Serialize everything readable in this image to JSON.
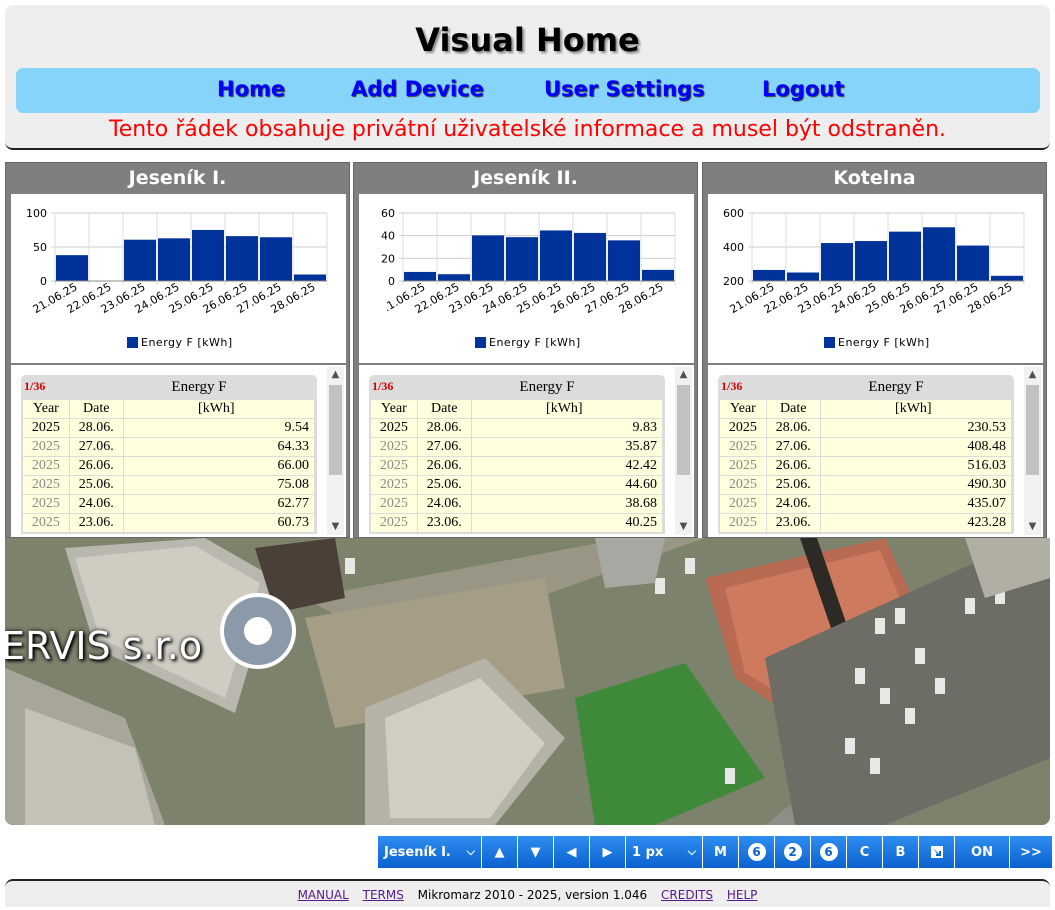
{
  "header": {
    "title": "Visual Home",
    "nav": [
      {
        "label": "Home",
        "name": "nav-home"
      },
      {
        "label": "Add Device",
        "name": "nav-add-device"
      },
      {
        "label": "User Settings",
        "name": "nav-user-settings"
      },
      {
        "label": "Logout",
        "name": "nav-logout"
      }
    ],
    "notice": "Tento řádek obsahuje privátní uživatelské informace a musel být odstraněn."
  },
  "panels": [
    {
      "title": "Jeseník I.",
      "table": {
        "page": "1/36",
        "column_title": "Energy F",
        "headers": [
          "Year",
          "Date",
          "[kWh]"
        ],
        "rows": [
          [
            "2025",
            "28.06.",
            "9.54"
          ],
          [
            "2025",
            "27.06.",
            "64.33"
          ],
          [
            "2025",
            "26.06.",
            "66.00"
          ],
          [
            "2025",
            "25.06.",
            "75.08"
          ],
          [
            "2025",
            "24.06.",
            "62.77"
          ],
          [
            "2025",
            "23.06.",
            "60.73"
          ]
        ]
      }
    },
    {
      "title": "Jeseník II.",
      "table": {
        "page": "1/36",
        "column_title": "Energy F",
        "headers": [
          "Year",
          "Date",
          "[kWh]"
        ],
        "rows": [
          [
            "2025",
            "28.06.",
            "9.83"
          ],
          [
            "2025",
            "27.06.",
            "35.87"
          ],
          [
            "2025",
            "26.06.",
            "42.42"
          ],
          [
            "2025",
            "25.06.",
            "44.60"
          ],
          [
            "2025",
            "24.06.",
            "38.68"
          ],
          [
            "2025",
            "23.06.",
            "40.25"
          ]
        ]
      }
    },
    {
      "title": "Kotelna",
      "table": {
        "page": "1/36",
        "column_title": "Energy F",
        "headers": [
          "Year",
          "Date",
          "[kWh]"
        ],
        "rows": [
          [
            "2025",
            "28.06.",
            "230.53"
          ],
          [
            "2025",
            "27.06.",
            "408.48"
          ],
          [
            "2025",
            "26.06.",
            "516.03"
          ],
          [
            "2025",
            "25.06.",
            "490.30"
          ],
          [
            "2025",
            "24.06.",
            "435.07"
          ],
          [
            "2025",
            "23.06.",
            "423.28"
          ]
        ]
      }
    }
  ],
  "chart_data": [
    {
      "type": "bar",
      "categories": [
        "21.06.25",
        "22.06.25",
        "23.06.25",
        "24.06.25",
        "25.06.25",
        "26.06.25",
        "27.06.25",
        "28.06.25"
      ],
      "series": [
        {
          "name": "Energy F [kWh]",
          "values": [
            38,
            0.5,
            60.73,
            62.77,
            75.08,
            66.0,
            64.33,
            9.54
          ]
        }
      ],
      "yticks": [
        0,
        50,
        100
      ],
      "ylim": [
        0,
        100
      ],
      "grid": true,
      "legend": "bottom",
      "color": "#00339a"
    },
    {
      "type": "bar",
      "categories": [
        ".1.06.25",
        "22.06.25",
        "23.06.25",
        "24.06.25",
        "25.06.25",
        "26.06.25",
        "27.06.25",
        "28.06.25"
      ],
      "series": [
        {
          "name": "Energy F [kWh]",
          "values": [
            8,
            6,
            40.25,
            38.68,
            44.6,
            42.42,
            35.87,
            9.83
          ]
        }
      ],
      "yticks": [
        0,
        20,
        40,
        60
      ],
      "ylim": [
        0,
        60
      ],
      "grid": true,
      "legend": "bottom",
      "color": "#00339a"
    },
    {
      "type": "bar",
      "categories": [
        "21.06.25",
        "22.06.25",
        "23.06.25",
        "24.06.25",
        "25.06.25",
        "26.06.25",
        "27.06.25",
        "28.06.25"
      ],
      "series": [
        {
          "name": "Energy F [kWh]",
          "values": [
            265,
            250,
            423.28,
            435.07,
            490.3,
            516.03,
            408.48,
            230.53
          ]
        }
      ],
      "yticks": [
        200,
        400,
        600
      ],
      "ylim": [
        200,
        600
      ],
      "grid": true,
      "legend": "bottom",
      "color": "#00339a"
    }
  ],
  "map": {
    "label": "ERVIS s.r.o"
  },
  "toolbar": {
    "device_select": "Jeseník I.",
    "up": "▲",
    "down": "▼",
    "left": "◀",
    "right": "▶",
    "px_select": "1 px",
    "m": "M",
    "b6a": "6",
    "b2": "2",
    "b6b": "6",
    "c": "C",
    "b": "B",
    "on": "ON",
    "more": ">>"
  },
  "footer": {
    "manual": "MANUAL",
    "terms": "TERMS",
    "copyright": "Mikromarz 2010 - 2025, version 1.046",
    "credits": "CREDITS",
    "help": "HELP"
  },
  "colors": {
    "nav_bg": "#87d4fb",
    "nav_text": "#0000ff",
    "notice": "#ff0000",
    "panel_bg": "#7f7f7f",
    "bar": "#00339a",
    "table_cell": "#ffffdd",
    "button": "#1877e4"
  }
}
